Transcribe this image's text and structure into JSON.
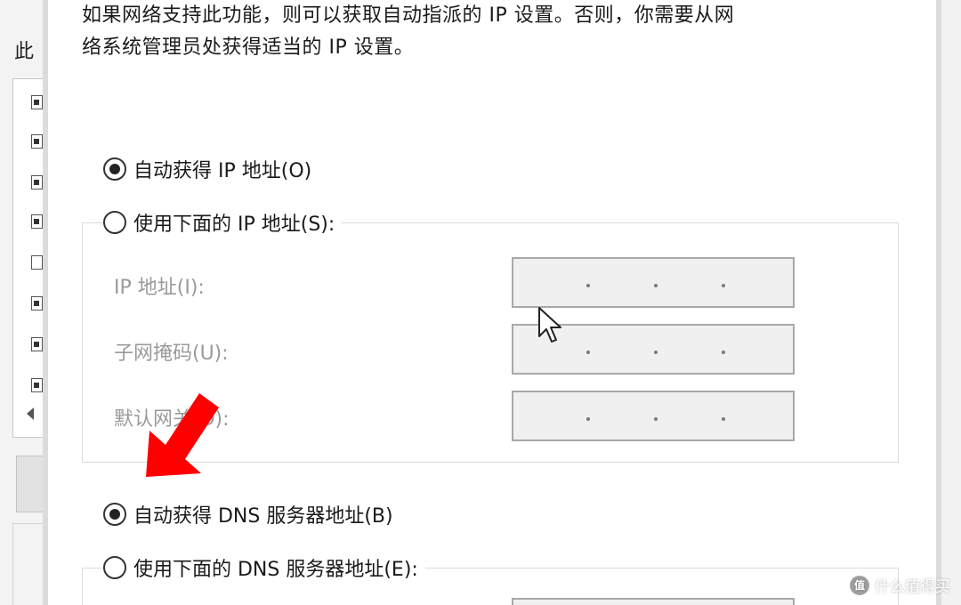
{
  "background_window": {
    "label": "此",
    "checkboxes": [
      true,
      true,
      true,
      true,
      false,
      true,
      true,
      true
    ]
  },
  "dialog": {
    "description_line1": "如果网络支持此功能，则可以获取自动指派的 IP 设置。否则，你需要从网",
    "description_line2": "络系统管理员处获得适当的 IP 设置。",
    "ip_section": {
      "auto_label": "自动获得 IP 地址(O)",
      "auto_checked": true,
      "manual_label": "使用下面的 IP 地址(S):",
      "manual_checked": false,
      "fields": [
        {
          "label": "IP 地址(I):",
          "value": ". . ."
        },
        {
          "label": "子网掩码(U):",
          "value": ". . ."
        },
        {
          "label": "默认网关(D):",
          "value": ". . ."
        }
      ]
    },
    "dns_section": {
      "auto_label": "自动获得 DNS 服务器地址(B)",
      "auto_checked": true,
      "manual_label": "使用下面的 DNS 服务器地址(E):",
      "manual_checked": false
    }
  },
  "overlay": {
    "arrow_color": "#ff0000",
    "watermark_logo": "值",
    "watermark_text": "什么值得买"
  }
}
